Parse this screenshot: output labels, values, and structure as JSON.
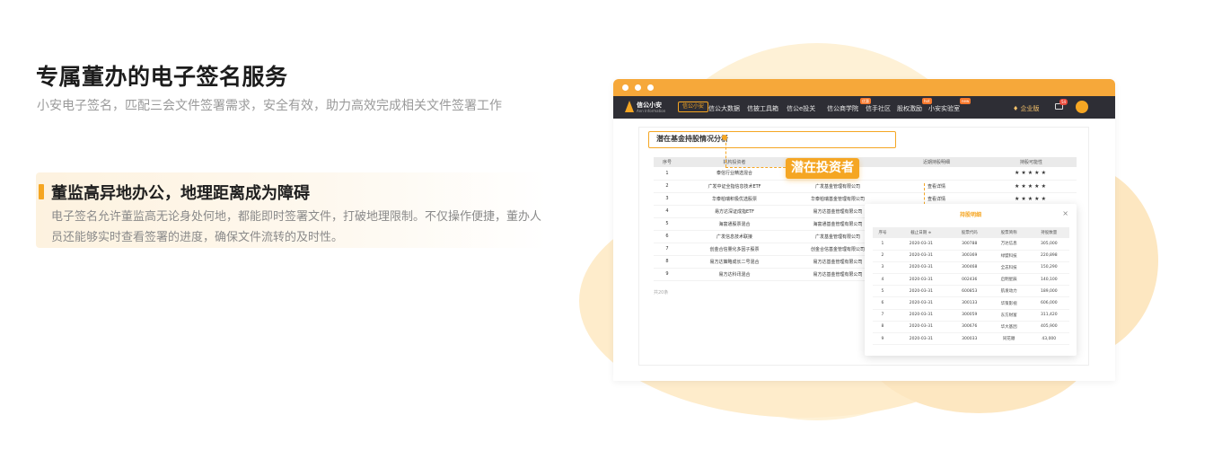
{
  "hero": {
    "title": "专属董办的电子签名服务",
    "subtitle": "小安电子签名，匹配三会文件签署需求，安全有效，助力高效完成相关文件签署工作"
  },
  "feature": {
    "title": "董监高异地办公，地理距离成为障碍",
    "description": "电子签名允许董监高无论身处何地，都能即时签署文件，打破地理限制。不仅操作便捷，董办人员还能够实时查看签署的进度，确保文件流转的及时性。"
  },
  "colors": {
    "accent": "#f5a623",
    "nav_bg": "#2e2e35",
    "blob": "#fde9c4"
  },
  "app": {
    "logo": "信公小安",
    "logo_en": "Ann Information",
    "brand_chip": "信公小安",
    "nav": [
      "信公大数据",
      "信披工具箱",
      "信公e投关",
      "信公商学院",
      "信手社区",
      "股权激励",
      "小安实验室"
    ],
    "nav_badges": [
      "优惠",
      "hot",
      "new"
    ],
    "enterprise": "企业版",
    "msg_count": "54"
  },
  "section": {
    "title": "潜在基金持股情况分析"
  },
  "callout": "潜在投资者",
  "main_table": {
    "headers": [
      "序号",
      "机构投资者",
      "",
      "近期持股明细",
      "持股可能性"
    ],
    "rows": [
      [
        "1",
        "泰信行业精选混合",
        "",
        "",
        "★★★★★"
      ],
      [
        "2",
        "广发中证全指信息技术ETF",
        "广发基金管理有限公司",
        "查看详情",
        "★★★★★"
      ],
      [
        "3",
        "华泰柏瑞积极优选股票",
        "华泰柏瑞基金管理有限公司",
        "查看详情",
        "★★★★★"
      ],
      [
        "4",
        "易方达深证成指ETF",
        "易方达基金管理有限公司",
        "",
        ""
      ],
      [
        "5",
        "海富通股票混合",
        "海富通基金管理有限公司",
        "",
        ""
      ],
      [
        "6",
        "广发信息技术联接",
        "广发基金管理有限公司",
        "",
        ""
      ],
      [
        "7",
        "创金合信量化多因子股票",
        "创金合信基金管理有限公司",
        "",
        ""
      ],
      [
        "8",
        "易方达策略成长二号混合",
        "易方达基金管理有限公司",
        "",
        ""
      ],
      [
        "9",
        "易方达科讯混合",
        "易方达基金管理有限公司",
        "",
        ""
      ]
    ],
    "footer": "共20条"
  },
  "popup": {
    "title": "持股明细",
    "close": "×",
    "headers": [
      "序号",
      "截止日期 ≑",
      "股票代码",
      "股票简称",
      "持股数量"
    ],
    "rows": [
      [
        "1",
        "2020-03-31",
        "300788",
        "万达信息",
        "305,000"
      ],
      [
        "2",
        "2020-03-31",
        "300369",
        "绿盟科技",
        "220,898"
      ],
      [
        "3",
        "2020-03-31",
        "300468",
        "全志科技",
        "150,290"
      ],
      [
        "4",
        "2020-03-31",
        "002436",
        "启明星辰",
        "140,100"
      ],
      [
        "5",
        "2020-03-31",
        "600853",
        "航发动力",
        "189,000"
      ],
      [
        "6",
        "2020-03-31",
        "300133",
        "华策影视",
        "606,000"
      ],
      [
        "7",
        "2020-03-31",
        "300059",
        "东方财富",
        "311,420"
      ],
      [
        "8",
        "2020-03-31",
        "300676",
        "华大基因",
        "405,900"
      ],
      [
        "9",
        "2020-03-31",
        "300033",
        "同花顺",
        "43,000"
      ]
    ]
  }
}
